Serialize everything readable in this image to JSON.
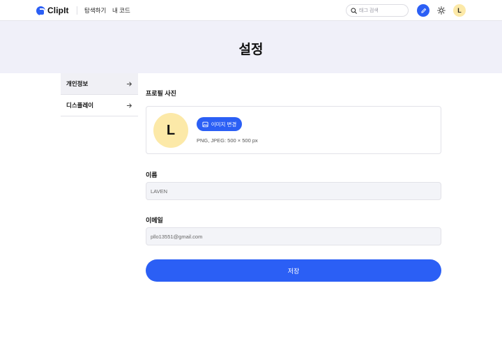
{
  "header": {
    "logo_text": "ClipIt",
    "nav": {
      "explore": "탐색하기",
      "my_code": "내 코드"
    },
    "search_placeholder": "태그 검색",
    "avatar_initial": "L"
  },
  "page": {
    "title": "설정"
  },
  "sidebar": {
    "items": [
      {
        "label": "개인정보",
        "active": true
      },
      {
        "label": "디스플레이",
        "active": false
      }
    ]
  },
  "profile": {
    "section_label": "프로필 사진",
    "avatar_initial": "L",
    "change_button": "이미지 변경",
    "hint": "PNG, JPEG: 500 × 500 px"
  },
  "form": {
    "name_label": "이름",
    "name_value": "LAVEN",
    "email_label": "이메일",
    "email_value": "pllo13551@gmail.com",
    "save_label": "저장"
  },
  "colors": {
    "accent": "#2b5ff5",
    "banner": "#f0f0f9",
    "avatar": "#fce9a8"
  }
}
